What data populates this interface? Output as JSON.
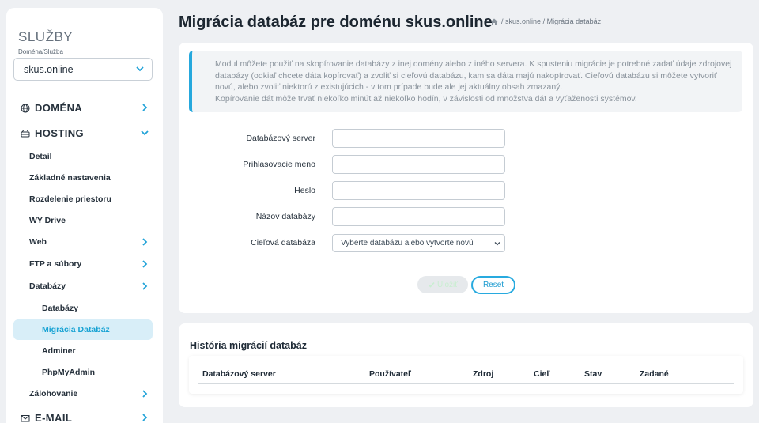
{
  "sidebar": {
    "title": "SLUŽBY",
    "subtitle": "Doména/Služba",
    "selected_domain": "skus.online",
    "top_items": [
      {
        "label": "DOMÉNA",
        "icon": "globe-icon"
      },
      {
        "label": "HOSTING",
        "icon": "server-icon"
      },
      {
        "label": "E-MAIL",
        "icon": "mail-icon"
      }
    ],
    "hosting_items": [
      {
        "label": "Detail"
      },
      {
        "label": "Základné nastavenia"
      },
      {
        "label": "Rozdelenie priestoru"
      },
      {
        "label": "WY Drive"
      },
      {
        "label": "Web"
      },
      {
        "label": "FTP a súbory"
      },
      {
        "label": "Databázy"
      },
      {
        "label": "Zálohovanie"
      }
    ],
    "database_items": [
      {
        "label": "Databázy"
      },
      {
        "label": "Migrácia Databáz"
      },
      {
        "label": "Adminer"
      },
      {
        "label": "PhpMyAdmin"
      }
    ]
  },
  "page": {
    "title": "Migrácia databáz pre doménu skus.online",
    "breadcrumb": {
      "sep": "/",
      "link": "skus.online",
      "current": "Migrácia databáz"
    }
  },
  "info": {
    "text": "Modul môžete použiť na skopírovanie databázy z inej domény alebo z iného servera. K spusteniu migrácie je potrebné zadať údaje zdrojovej databázy (odkiaľ chcete dáta kopírovať) a zvoliť si cieľovú databázu, kam sa dáta majú nakopírovať. Cieľovú databázu si môžete vytvoriť novú, alebo zvoliť niektorú z existujúcich - v tom prípade bude ale jej aktuálny obsah zmazaný.",
    "text2": "Kopírovanie dát môže trvať niekoľko minút až niekoľko hodín, v závislosti od množstva dát a vyťaženosti systémov."
  },
  "form": {
    "server_label": "Databázový server",
    "server_value": "",
    "login_label": "Prihlasovacie meno",
    "login_value": "",
    "password_label": "Heslo",
    "password_value": "",
    "dbname_label": "Názov databázy",
    "dbname_value": "",
    "target_label": "Cieľová databáza",
    "target_value": "Vyberte databázu alebo vytvorte novú",
    "save_label": "Uložiť",
    "reset_label": "Reset"
  },
  "history": {
    "title": "História migrácií databáz",
    "columns": [
      "Databázový server",
      "Používateľ",
      "Zdroj",
      "Cieľ",
      "Stav",
      "Zadané"
    ]
  },
  "colors": {
    "accent": "#26a8dd",
    "active_bg": "#d8eef8",
    "background": "#eef0f3"
  }
}
